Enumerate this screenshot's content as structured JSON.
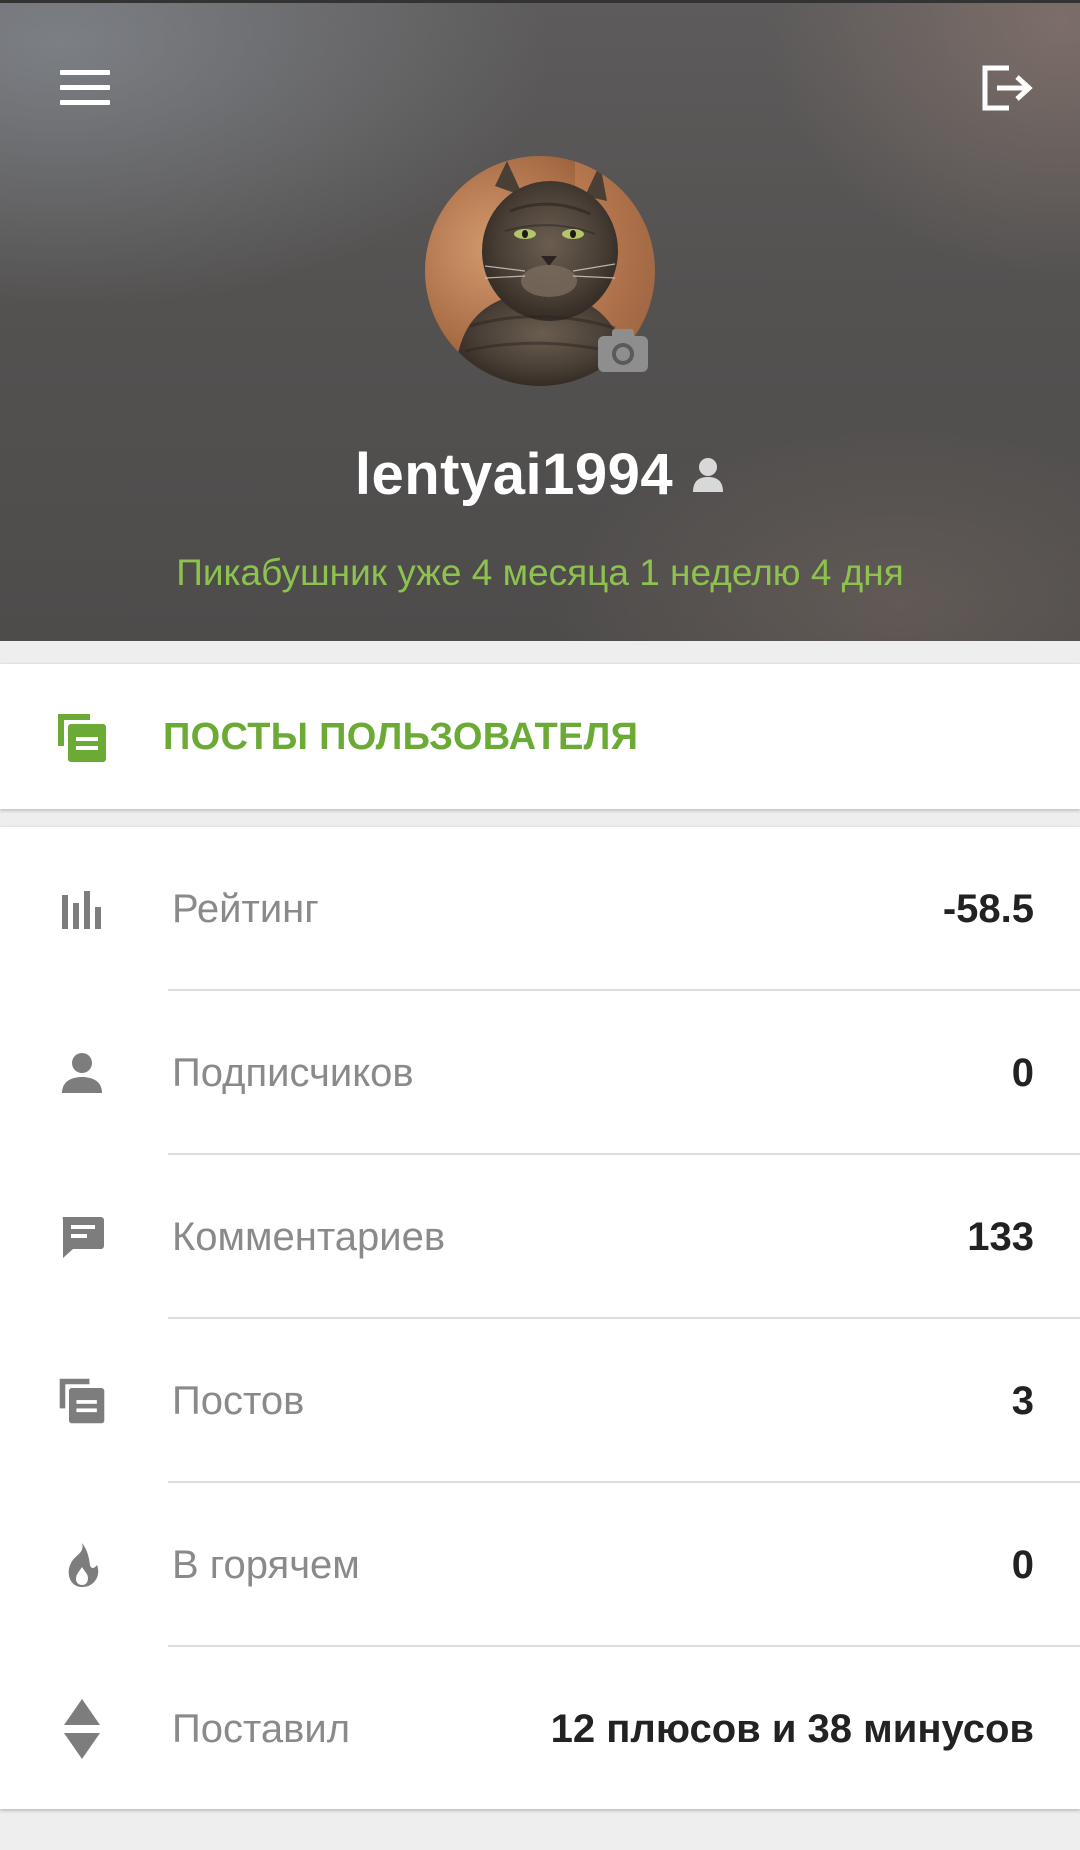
{
  "profile": {
    "username": "lentyai1994",
    "tenure_text": "Пикабушник уже 4 месяца 1 неделю 4 дня",
    "avatar_icon": "cat-photo-avatar",
    "camera_icon": "camera-icon"
  },
  "header": {
    "menu_icon": "hamburger-menu-icon",
    "logout_icon": "logout-icon"
  },
  "posts_button": {
    "label": "ПОСТЫ ПОЛЬЗОВАТЕЛЯ",
    "icon": "posts-stack-icon"
  },
  "stats": [
    {
      "label": "Рейтинг",
      "value": "-58.5",
      "icon": "bar-chart-icon"
    },
    {
      "label": "Подписчиков",
      "value": "0",
      "icon": "person-icon"
    },
    {
      "label": "Комментариев",
      "value": "133",
      "icon": "comment-icon"
    },
    {
      "label": "Постов",
      "value": "3",
      "icon": "posts-stack-icon"
    },
    {
      "label": "В горячем",
      "value": "0",
      "icon": "flame-icon"
    },
    {
      "label": "Поставил",
      "value": "12 плюсов и 38 минусов",
      "icon": "up-down-arrows-icon"
    }
  ],
  "colors": {
    "accent_green": "#8dc24f",
    "label_green": "#6aaa35",
    "icon_gray": "#7d7d7d",
    "label_gray": "#8a8a8a"
  }
}
